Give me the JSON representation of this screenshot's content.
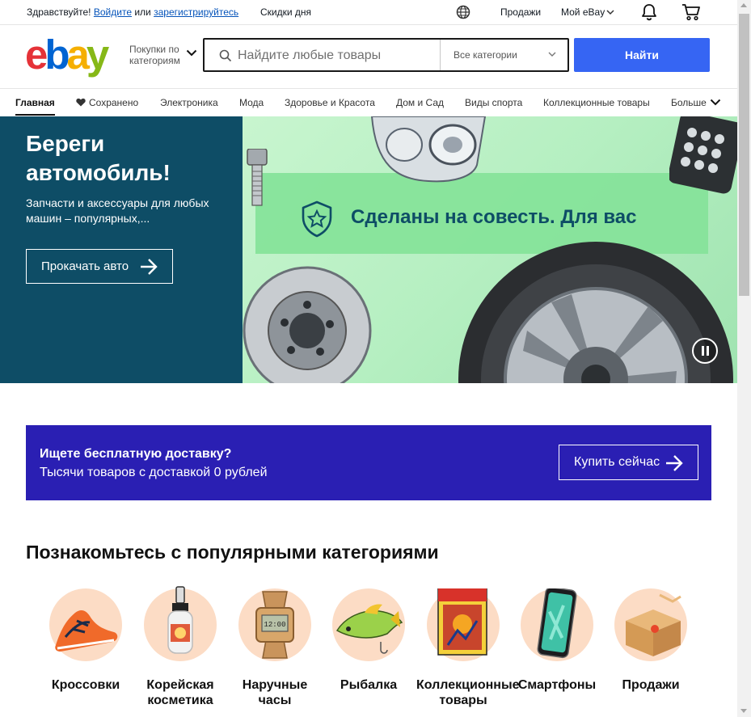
{
  "topbar": {
    "greeting": "Здравствуйте!",
    "signin_link": "Войдите",
    "or_text": "или",
    "register_link": "зарегистрируйтесь",
    "deals": "Скидки дня",
    "sell": "Продажи",
    "my_ebay": "Мой eBay"
  },
  "header": {
    "logo_letters": [
      "e",
      "b",
      "a",
      "y"
    ],
    "logo_colors": [
      "#e53238",
      "#0064d2",
      "#f5af02",
      "#86b817"
    ],
    "shop_by_category": "Покупки по категориям",
    "search_placeholder": "Найдите любые товары",
    "category_select": "Все категории",
    "search_button": "Найти"
  },
  "nav": {
    "items": [
      {
        "label": "Главная"
      },
      {
        "label": "Сохранено"
      },
      {
        "label": "Электроника"
      },
      {
        "label": "Мода"
      },
      {
        "label": "Здоровье и Красота"
      },
      {
        "label": "Дом и Сад"
      },
      {
        "label": "Виды спорта"
      },
      {
        "label": "Коллекционные товары"
      },
      {
        "label": "Больше"
      }
    ]
  },
  "hero": {
    "title": "Береги автомобиль!",
    "subtitle": "Запчасти и аксессуары для любых машин – популярных,...",
    "button": "Прокачать авто",
    "banner_text": "Сделаны на совесть. Для вас"
  },
  "promo": {
    "title": "Ищете бесплатную доставку?",
    "description": "Тысячи товаров с доставкой 0 рублей",
    "button": "Купить сейчас"
  },
  "categories": {
    "title": "Познакомьтесь с популярными категориями",
    "items": [
      {
        "label": "Кроссовки",
        "icon": "sneaker-icon"
      },
      {
        "label": "Корейская косметика",
        "icon": "cosmetics-icon"
      },
      {
        "label": "Наручные часы",
        "icon": "watch-icon"
      },
      {
        "label": "Рыбалка",
        "icon": "fishing-lure-icon"
      },
      {
        "label": "Коллекционные товары",
        "icon": "comic-book-icon"
      },
      {
        "label": "Смартфоны",
        "icon": "smartphone-icon"
      },
      {
        "label": "Продажи",
        "icon": "package-icon"
      }
    ]
  },
  "colors": {
    "accent": "#3665f3",
    "hero_bg": "#0e4d66",
    "promo_bg": "#2a1fb3",
    "category_circle": "#fcdcc5"
  }
}
